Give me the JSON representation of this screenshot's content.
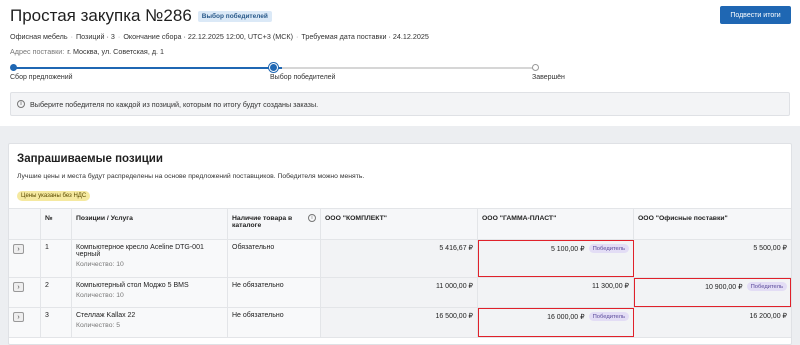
{
  "header": {
    "title": "Простая закупка №286",
    "stage_badge": "Выбор победителей",
    "summary_button": "Подвести итоги",
    "meta": {
      "category": "Офисная мебель",
      "positions": "Позиций · 3",
      "collection_end": "Окончание сбора · 22.12.2025 12:00, UTC+3 (МСК)",
      "delivery_date": "Требуемая дата поставки · 24.12.2025"
    },
    "address_label": "Адрес поставки:",
    "address_value": "г. Москва, ул. Советская, д. 1"
  },
  "stepper": {
    "steps": [
      "Сбор предложений",
      "Выбор победителей",
      "Завершён"
    ],
    "current_index": 1
  },
  "alert": {
    "text": "Выберите победителя по каждой из позиций, которым по итогу будут созданы заказы."
  },
  "positions_card": {
    "title": "Запрашиваемые позиции",
    "subtitle": "Лучшие цены и места будут распределены на основе предложений поставщиков. Победителя можно менять.",
    "vat_badge": "Цены указаны без НДС",
    "columns": {
      "num": "№",
      "name": "Позиции / Услуга",
      "availability": "Наличие товара в каталоге",
      "supplier1": "ООО \"КОМПЛЕКТ\"",
      "supplier2": "ООО \"ГАММА-ПЛАСТ\"",
      "supplier3": "ООО \"Офисные поставки\""
    },
    "winner_label": "Победитель",
    "rows": [
      {
        "num": "1",
        "name": "Компьютерное кресло Aceline DTG-001 черный",
        "qty": "Количество: 10",
        "availability": "Обязательно",
        "price1": "5 416,67 ₽",
        "price2": "5 100,00 ₽",
        "price3": "5 500,00 ₽"
      },
      {
        "num": "2",
        "name": "Компьютерный стол Моджо 5 BMS",
        "qty": "Количество: 10",
        "availability": "Не обязательно",
        "price1": "11 000,00 ₽",
        "price2": "11 300,00 ₽",
        "price3": "10 900,00 ₽"
      },
      {
        "num": "3",
        "name": "Стеллаж Kallax 22",
        "qty": "Количество: 5",
        "availability": "Не обязательно",
        "price1": "16 500,00 ₽",
        "price2": "16 000,00 ₽",
        "price3": "16 200,00 ₽"
      }
    ]
  },
  "colors": {
    "accent": "#1f67b3",
    "selection": "#e0212a",
    "vat_badge_bg": "#f5e9a0",
    "winner_badge_bg": "#e3ddf5"
  },
  "icons": {
    "info": "info-icon",
    "expand": "chevron-right-icon"
  }
}
